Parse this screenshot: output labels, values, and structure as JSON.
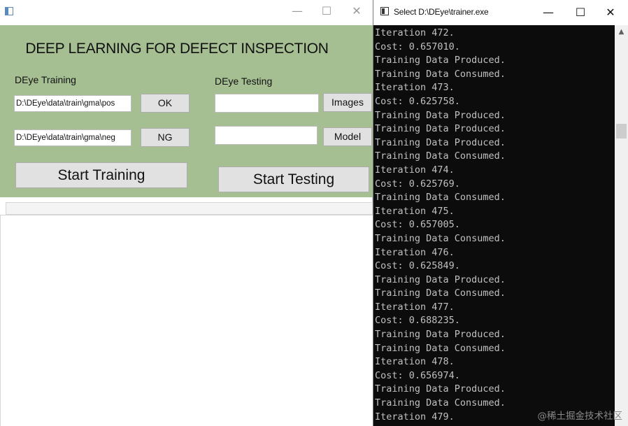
{
  "app": {
    "minimize": "—",
    "maximize": "☐",
    "close": "✕",
    "title": "DEEP LEARNING FOR DEFECT INSPECTION",
    "training": {
      "label": "DEye Training",
      "pos_path": "D:\\DEye\\data\\train\\gma\\pos",
      "neg_path": "D:\\DEye\\data\\train\\gma\\neg",
      "ok_button": "OK",
      "ng_button": "NG",
      "start_button": "Start Training"
    },
    "testing": {
      "label": "DEye Testing",
      "images_path": "",
      "model_path": "",
      "images_button": "Images",
      "model_button": "Model",
      "start_button": "Start Testing"
    }
  },
  "console": {
    "title": "Select D:\\DEye\\trainer.exe",
    "minimize": "—",
    "maximize": "☐",
    "close": "✕",
    "scroll_up": "▲",
    "lines": [
      "Iteration 472.",
      "Cost: 0.657010.",
      "Training Data Produced.",
      "Training Data Consumed.",
      "Iteration 473.",
      "Cost: 0.625758.",
      "Training Data Produced.",
      "Training Data Produced.",
      "Training Data Produced.",
      "Training Data Consumed.",
      "Iteration 474.",
      "Cost: 0.625769.",
      "Training Data Consumed.",
      "Iteration 475.",
      "Cost: 0.657005.",
      "Training Data Consumed.",
      "Iteration 476.",
      "Cost: 0.625849.",
      "Training Data Produced.",
      "Training Data Consumed.",
      "Iteration 477.",
      "Cost: 0.688235.",
      "Training Data Produced.",
      "Training Data Consumed.",
      "Iteration 478.",
      "Cost: 0.656974.",
      "Training Data Produced.",
      "Training Data Consumed.",
      "Iteration 479."
    ]
  },
  "watermark": "@稀土掘金技术社区"
}
